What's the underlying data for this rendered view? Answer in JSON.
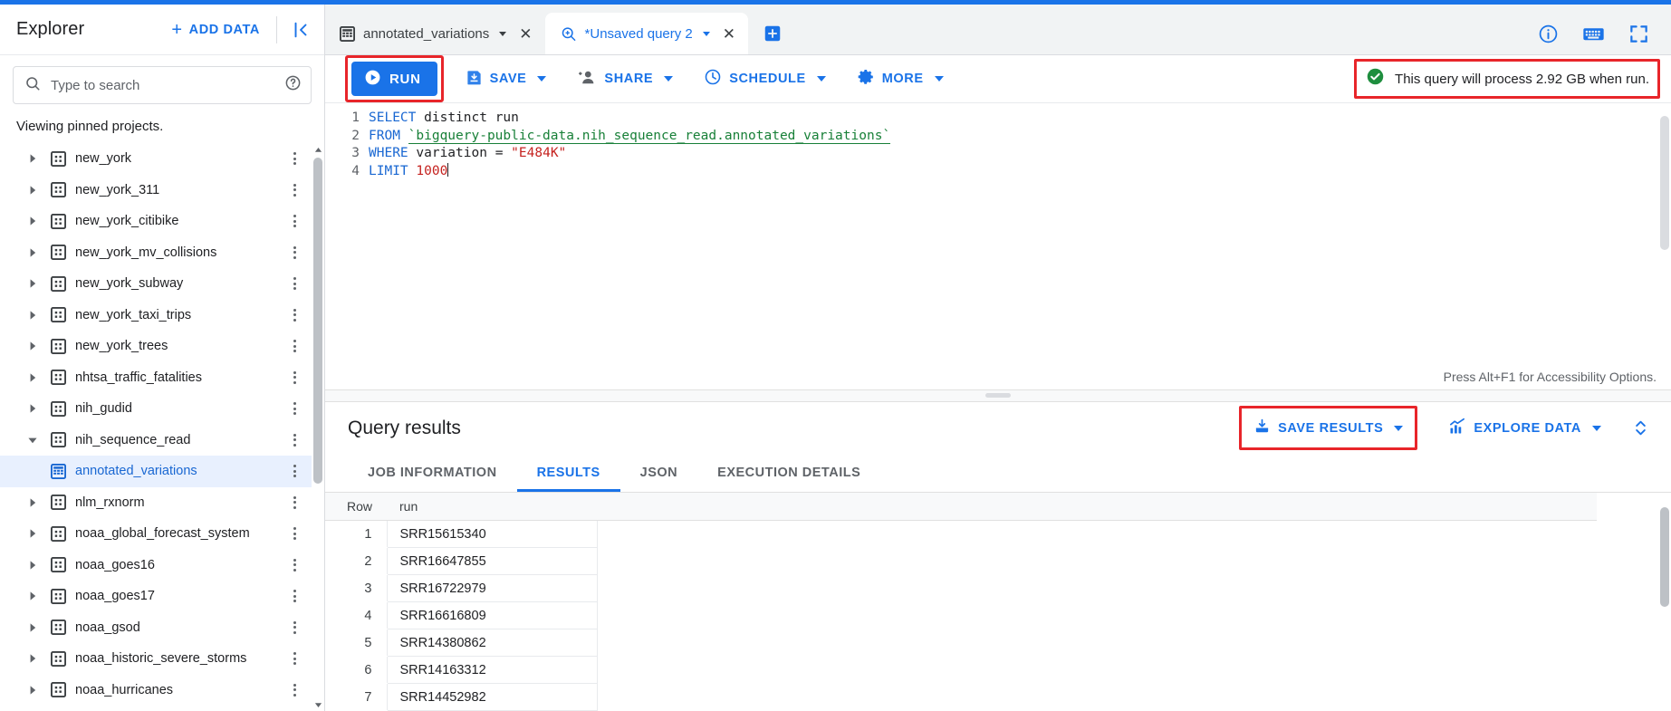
{
  "accent": "#1a73e8",
  "highlight_box_color": "#e8252a",
  "sidebar": {
    "title": "Explorer",
    "add_data_label": "ADD DATA",
    "add_data_icon": "plus-icon",
    "collapse_icon": "collapse-panel-icon",
    "search": {
      "placeholder": "Type to search",
      "value": "",
      "icon": "search-icon",
      "help_icon": "help-circle-icon"
    },
    "pinned_note": "Viewing pinned projects.",
    "items": [
      {
        "label": "new_york",
        "icon": "dataset-icon",
        "expanded": false,
        "selected": false,
        "child": false
      },
      {
        "label": "new_york_311",
        "icon": "dataset-icon",
        "expanded": false,
        "selected": false,
        "child": false
      },
      {
        "label": "new_york_citibike",
        "icon": "dataset-icon",
        "expanded": false,
        "selected": false,
        "child": false
      },
      {
        "label": "new_york_mv_collisions",
        "icon": "dataset-icon",
        "expanded": false,
        "selected": false,
        "child": false
      },
      {
        "label": "new_york_subway",
        "icon": "dataset-icon",
        "expanded": false,
        "selected": false,
        "child": false
      },
      {
        "label": "new_york_taxi_trips",
        "icon": "dataset-icon",
        "expanded": false,
        "selected": false,
        "child": false
      },
      {
        "label": "new_york_trees",
        "icon": "dataset-icon",
        "expanded": false,
        "selected": false,
        "child": false
      },
      {
        "label": "nhtsa_traffic_fatalities",
        "icon": "dataset-icon",
        "expanded": false,
        "selected": false,
        "child": false
      },
      {
        "label": "nih_gudid",
        "icon": "dataset-icon",
        "expanded": false,
        "selected": false,
        "child": false
      },
      {
        "label": "nih_sequence_read",
        "icon": "dataset-icon",
        "expanded": true,
        "selected": false,
        "child": false
      },
      {
        "label": "annotated_variations",
        "icon": "table-icon",
        "expanded": false,
        "selected": true,
        "child": true
      },
      {
        "label": "nlm_rxnorm",
        "icon": "dataset-icon",
        "expanded": false,
        "selected": false,
        "child": false
      },
      {
        "label": "noaa_global_forecast_system",
        "icon": "dataset-icon",
        "expanded": false,
        "selected": false,
        "child": false
      },
      {
        "label": "noaa_goes16",
        "icon": "dataset-icon",
        "expanded": false,
        "selected": false,
        "child": false
      },
      {
        "label": "noaa_goes17",
        "icon": "dataset-icon",
        "expanded": false,
        "selected": false,
        "child": false
      },
      {
        "label": "noaa_gsod",
        "icon": "dataset-icon",
        "expanded": false,
        "selected": false,
        "child": false
      },
      {
        "label": "noaa_historic_severe_storms",
        "icon": "dataset-icon",
        "expanded": false,
        "selected": false,
        "child": false
      },
      {
        "label": "noaa_hurricanes",
        "icon": "dataset-icon",
        "expanded": false,
        "selected": false,
        "child": false
      }
    ]
  },
  "tabs": [
    {
      "label": "annotated_variations",
      "icon": "table-icon",
      "active": false,
      "has_caret": true,
      "has_close": true
    },
    {
      "label": "*Unsaved query 2",
      "icon": "query-icon",
      "active": true,
      "has_caret": true,
      "has_close": true
    }
  ],
  "new_tab_icon": "add-tab-icon",
  "header_icons": [
    {
      "name": "info-icon"
    },
    {
      "name": "keyboard-icon"
    },
    {
      "name": "fullscreen-icon"
    }
  ],
  "toolbar": {
    "run_label": "RUN",
    "run_icon": "play-icon",
    "buttons": [
      {
        "label": "SAVE",
        "icon": "save-icon",
        "caret": true
      },
      {
        "label": "SHARE",
        "icon": "share-person-icon",
        "caret": true
      },
      {
        "label": "SCHEDULE",
        "icon": "clock-icon",
        "caret": true
      },
      {
        "label": "MORE",
        "icon": "gear-icon",
        "caret": true
      }
    ],
    "validator": {
      "icon": "check-circle-icon",
      "icon_color": "#1e8e3e",
      "text": "This query will process 2.92 GB when run."
    }
  },
  "editor": {
    "line_numbers": [
      "1",
      "2",
      "3",
      "4"
    ],
    "lines": [
      {
        "tokens": [
          {
            "t": "SELECT",
            "c": "k"
          },
          {
            "t": " ",
            "c": "idt"
          },
          {
            "t": "distinct",
            "c": "idt"
          },
          {
            "t": " ",
            "c": "idt"
          },
          {
            "t": "run",
            "c": "idt"
          }
        ]
      },
      {
        "tokens": [
          {
            "t": "FROM",
            "c": "k"
          },
          {
            "t": " ",
            "c": "idt"
          },
          {
            "t": "`bigquery-public-data.nih_sequence_read.annotated_variations`",
            "c": "tbl"
          }
        ]
      },
      {
        "tokens": [
          {
            "t": "WHERE",
            "c": "k"
          },
          {
            "t": " ",
            "c": "idt"
          },
          {
            "t": "variation",
            "c": "idt"
          },
          {
            "t": " = ",
            "c": "idt"
          },
          {
            "t": "\"E484K\"",
            "c": "str"
          }
        ]
      },
      {
        "tokens": [
          {
            "t": "LIMIT",
            "c": "k"
          },
          {
            "t": " ",
            "c": "idt"
          },
          {
            "t": "1000",
            "c": "num"
          }
        ]
      }
    ],
    "plain_text": "SELECT distinct run\nFROM `bigquery-public-data.nih_sequence_read.annotated_variations`\nWHERE variation = \"E484K\"\nLIMIT 1000",
    "a11y_hint": "Press Alt+F1 for Accessibility Options."
  },
  "results": {
    "title": "Query results",
    "save_results_label": "SAVE RESULTS",
    "save_results_icon": "download-icon",
    "explore_data_label": "EXPLORE DATA",
    "explore_data_icon": "chart-icon",
    "expand_icon": "expand-collapse-icon",
    "tabs": [
      {
        "label": "JOB INFORMATION",
        "active": false
      },
      {
        "label": "RESULTS",
        "active": true
      },
      {
        "label": "JSON",
        "active": false
      },
      {
        "label": "EXECUTION DETAILS",
        "active": false
      }
    ],
    "columns": [
      "Row",
      "run"
    ],
    "rows": [
      {
        "row": "1",
        "run": "SRR15615340"
      },
      {
        "row": "2",
        "run": "SRR16647855"
      },
      {
        "row": "3",
        "run": "SRR16722979"
      },
      {
        "row": "4",
        "run": "SRR16616809"
      },
      {
        "row": "5",
        "run": "SRR14380862"
      },
      {
        "row": "6",
        "run": "SRR14163312"
      },
      {
        "row": "7",
        "run": "SRR14452982"
      }
    ]
  }
}
